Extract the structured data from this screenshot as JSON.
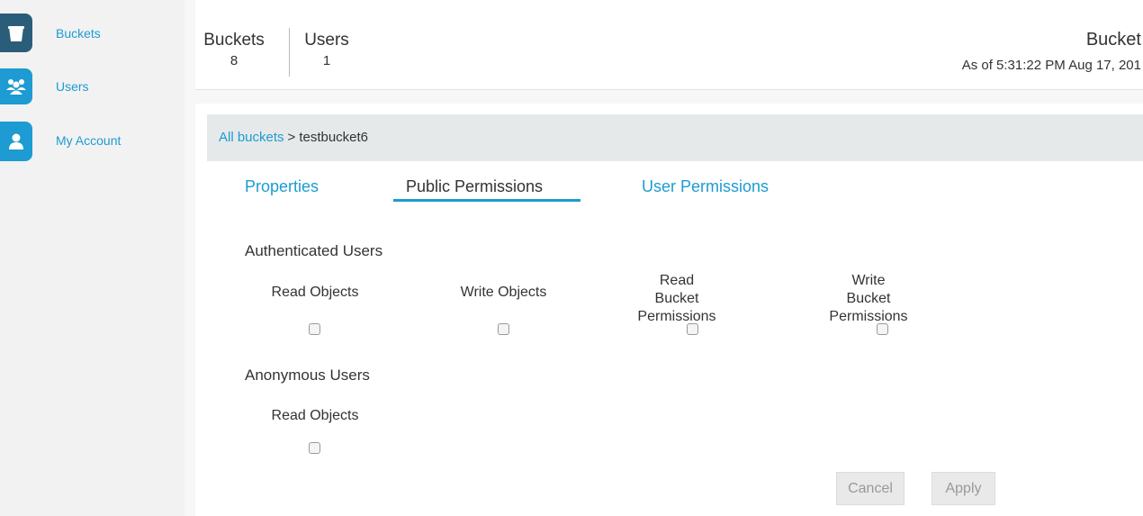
{
  "sidebar": {
    "items": [
      {
        "label": "Buckets",
        "icon": "bucket-icon",
        "active": true
      },
      {
        "label": "Users",
        "icon": "users-icon",
        "active": false
      },
      {
        "label": "My Account",
        "icon": "user-icon",
        "active": false
      }
    ]
  },
  "header": {
    "stats": [
      {
        "label": "Buckets",
        "value": "8"
      },
      {
        "label": "Users",
        "value": "1"
      }
    ],
    "title": "Bucket",
    "timestamp": "As of 5:31:22 PM Aug 17, 201"
  },
  "breadcrumb": {
    "root": "All buckets",
    "separator": ">",
    "current": "testbucket6"
  },
  "tabs": [
    {
      "label": "Properties",
      "active": false
    },
    {
      "label": "Public Permissions",
      "active": true
    },
    {
      "label": "User Permissions",
      "active": false
    }
  ],
  "authenticated": {
    "title": "Authenticated Users",
    "permissions": [
      {
        "label": "Read Objects",
        "checked": false
      },
      {
        "label": "Write Objects",
        "checked": false
      },
      {
        "label": "Read Bucket Permissions",
        "checked": false
      },
      {
        "label": "Write Bucket Permissions",
        "checked": false
      }
    ]
  },
  "anonymous": {
    "title": "Anonymous Users",
    "permissions": [
      {
        "label": "Read Objects",
        "checked": false
      }
    ]
  },
  "actions": {
    "cancel": "Cancel",
    "apply": "Apply"
  },
  "colors": {
    "accent": "#1d9bd2",
    "active_nav": "#2a5d7a"
  }
}
